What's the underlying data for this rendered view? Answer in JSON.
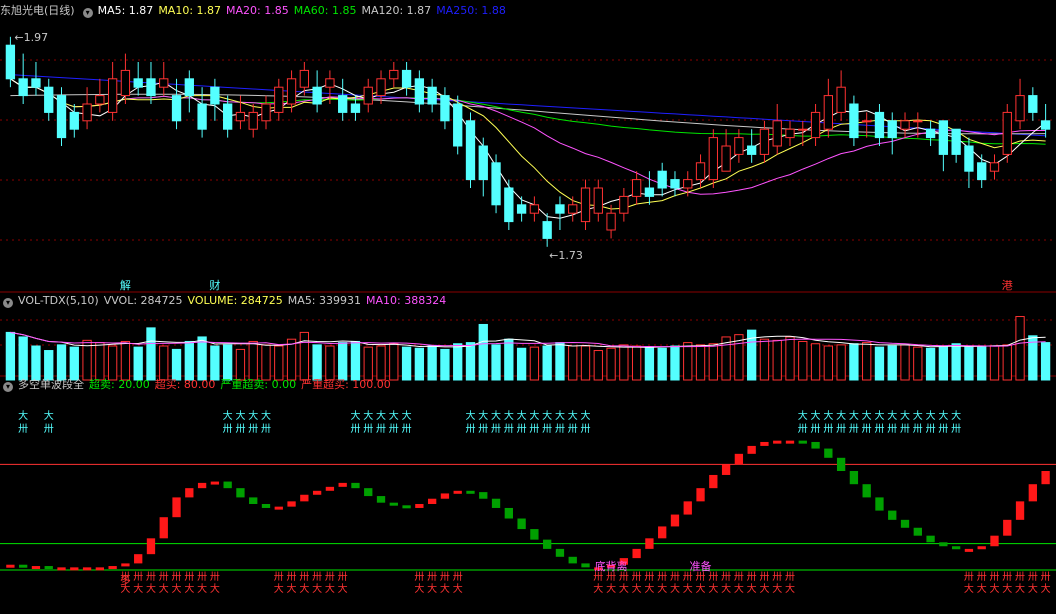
{
  "stock": {
    "name": "东旭光电",
    "period": "(日线)"
  },
  "colors": {
    "up": "#ff3232",
    "down": "#54ffff",
    "ma5": "#ffffff",
    "ma10": "#ffff54",
    "ma20": "#ff54ff",
    "ma60": "#00e600",
    "ma120": "#c8c8c8",
    "ma250": "#1f1fff",
    "grid": "#8a0000",
    "wave_up": "#ff1818",
    "wave_down": "#00a000",
    "sig_cyan": "#54ffff",
    "sig_red": "#ff3232"
  },
  "main": {
    "ma_labels": [
      {
        "text": "MA5: 1.87",
        "key": "ma5"
      },
      {
        "text": "MA10: 1.87",
        "key": "ma10"
      },
      {
        "text": "MA20: 1.85",
        "key": "ma20"
      },
      {
        "text": "MA60: 1.85",
        "key": "ma60"
      },
      {
        "text": "MA120: 1.87",
        "key": "ma120"
      },
      {
        "text": "MA250: 1.88",
        "key": "ma250"
      }
    ],
    "high_label": "1.97",
    "low_label": "1.73",
    "events": [
      {
        "text": "解",
        "index": 9
      },
      {
        "text": "财",
        "index": 16
      },
      {
        "text": "港",
        "index": 78
      }
    ]
  },
  "volume": {
    "labels": [
      {
        "text": "VOL-TDX(5,10)",
        "color": "#c8c8c8"
      },
      {
        "text": "VVOL: 284725",
        "color": "#c8c8c8"
      },
      {
        "text": "VOLUME: 284725",
        "color": "#ffff54"
      },
      {
        "text": "MA5: 339931",
        "color": "#c8c8c8"
      },
      {
        "text": "MA10: 388324",
        "color": "#ff54ff"
      }
    ]
  },
  "indicator": {
    "labels": [
      {
        "text": "多空单波段全",
        "color": "#c8c8c8"
      },
      {
        "text": "超卖: 20.00",
        "color": "#00e600"
      },
      {
        "text": "超买: 80.00",
        "color": "#ff3232"
      },
      {
        "text": "严重超卖: 0.00",
        "color": "#00e600"
      },
      {
        "text": "严重超买: 100.00",
        "color": "#ff3232"
      }
    ],
    "annotations": [
      {
        "text": "多",
        "index": 9,
        "color": "#ff3232"
      },
      {
        "text": "底背离",
        "index": 47,
        "color": "#ff54ff"
      },
      {
        "text": "准备",
        "index": 54,
        "color": "#ff54ff"
      }
    ]
  },
  "chart_data": [
    {
      "type": "candlestick",
      "title": "东旭光电 (日线)",
      "x": [
        0,
        1,
        2,
        3,
        4,
        5,
        6,
        7,
        8,
        9,
        10,
        11,
        12,
        13,
        14,
        15,
        16,
        17,
        18,
        19,
        20,
        21,
        22,
        23,
        24,
        25,
        26,
        27,
        28,
        29,
        30,
        31,
        32,
        33,
        34,
        35,
        36,
        37,
        38,
        39,
        40,
        41,
        42,
        43,
        44,
        45,
        46,
        47,
        48,
        49,
        50,
        51,
        52,
        53,
        54,
        55,
        56,
        57,
        58,
        59,
        60,
        61,
        62,
        63,
        64,
        65,
        66,
        67,
        68,
        69,
        70,
        71,
        72,
        73,
        74,
        75,
        76,
        77,
        78,
        79,
        80,
        81
      ],
      "open": [
        1.97,
        1.93,
        1.93,
        1.92,
        1.91,
        1.89,
        1.88,
        1.9,
        1.89,
        1.91,
        1.93,
        1.93,
        1.92,
        1.91,
        1.93,
        1.9,
        1.92,
        1.9,
        1.88,
        1.87,
        1.88,
        1.89,
        1.9,
        1.92,
        1.92,
        1.92,
        1.91,
        1.9,
        1.9,
        1.91,
        1.93,
        1.94,
        1.93,
        1.92,
        1.91,
        1.9,
        1.88,
        1.85,
        1.83,
        1.8,
        1.78,
        1.77,
        1.76,
        1.78,
        1.77,
        1.76,
        1.77,
        1.75,
        1.77,
        1.79,
        1.8,
        1.82,
        1.81,
        1.8,
        1.81,
        1.81,
        1.82,
        1.84,
        1.85,
        1.84,
        1.85,
        1.86,
        1.87,
        1.86,
        1.87,
        1.89,
        1.9,
        1.88,
        1.89,
        1.88,
        1.87,
        1.88,
        1.87,
        1.88,
        1.87,
        1.85,
        1.83,
        1.82,
        1.84,
        1.88,
        1.91,
        1.88
      ],
      "close": [
        1.93,
        1.91,
        1.92,
        1.89,
        1.86,
        1.87,
        1.9,
        1.91,
        1.93,
        1.94,
        1.92,
        1.91,
        1.93,
        1.88,
        1.91,
        1.87,
        1.9,
        1.87,
        1.89,
        1.89,
        1.9,
        1.92,
        1.93,
        1.94,
        1.9,
        1.93,
        1.89,
        1.89,
        1.92,
        1.93,
        1.94,
        1.92,
        1.9,
        1.9,
        1.88,
        1.85,
        1.81,
        1.81,
        1.78,
        1.76,
        1.77,
        1.78,
        1.74,
        1.77,
        1.78,
        1.8,
        1.8,
        1.77,
        1.79,
        1.81,
        1.79,
        1.8,
        1.8,
        1.81,
        1.83,
        1.86,
        1.85,
        1.86,
        1.84,
        1.87,
        1.88,
        1.87,
        1.87,
        1.89,
        1.91,
        1.92,
        1.86,
        1.88,
        1.86,
        1.86,
        1.88,
        1.88,
        1.86,
        1.84,
        1.84,
        1.82,
        1.81,
        1.83,
        1.89,
        1.91,
        1.89,
        1.87
      ],
      "high": [
        1.98,
        1.96,
        1.95,
        1.93,
        1.92,
        1.9,
        1.92,
        1.93,
        1.95,
        1.96,
        1.95,
        1.95,
        1.95,
        1.93,
        1.94,
        1.92,
        1.93,
        1.91,
        1.91,
        1.9,
        1.91,
        1.93,
        1.94,
        1.95,
        1.94,
        1.94,
        1.93,
        1.91,
        1.93,
        1.94,
        1.95,
        1.95,
        1.94,
        1.93,
        1.92,
        1.91,
        1.89,
        1.86,
        1.84,
        1.81,
        1.79,
        1.79,
        1.77,
        1.79,
        1.79,
        1.81,
        1.81,
        1.78,
        1.8,
        1.82,
        1.82,
        1.83,
        1.82,
        1.82,
        1.84,
        1.87,
        1.87,
        1.87,
        1.87,
        1.88,
        1.9,
        1.88,
        1.88,
        1.9,
        1.93,
        1.94,
        1.91,
        1.89,
        1.9,
        1.89,
        1.89,
        1.89,
        1.88,
        1.88,
        1.87,
        1.86,
        1.84,
        1.84,
        1.9,
        1.93,
        1.92,
        1.9
      ],
      "low": [
        1.92,
        1.9,
        1.91,
        1.88,
        1.85,
        1.86,
        1.87,
        1.89,
        1.88,
        1.9,
        1.91,
        1.9,
        1.91,
        1.87,
        1.89,
        1.86,
        1.88,
        1.86,
        1.87,
        1.86,
        1.87,
        1.88,
        1.89,
        1.91,
        1.89,
        1.9,
        1.88,
        1.88,
        1.89,
        1.9,
        1.92,
        1.91,
        1.89,
        1.89,
        1.87,
        1.84,
        1.8,
        1.79,
        1.77,
        1.75,
        1.76,
        1.76,
        1.73,
        1.75,
        1.76,
        1.75,
        1.76,
        1.74,
        1.76,
        1.78,
        1.78,
        1.79,
        1.79,
        1.79,
        1.8,
        1.8,
        1.82,
        1.83,
        1.83,
        1.83,
        1.84,
        1.85,
        1.85,
        1.85,
        1.86,
        1.88,
        1.85,
        1.86,
        1.85,
        1.84,
        1.86,
        1.86,
        1.85,
        1.82,
        1.83,
        1.8,
        1.8,
        1.81,
        1.83,
        1.87,
        1.88,
        1.86
      ],
      "ylim": [
        1.7,
        2.0
      ]
    },
    {
      "type": "bar",
      "title": "VOL-TDX(5,10)",
      "values": [
        420,
        380,
        300,
        260,
        310,
        290,
        350,
        330,
        300,
        340,
        290,
        460,
        300,
        270,
        340,
        380,
        300,
        310,
        270,
        340,
        310,
        300,
        360,
        420,
        310,
        300,
        330,
        340,
        290,
        300,
        320,
        290,
        280,
        300,
        270,
        320,
        330,
        490,
        310,
        360,
        280,
        290,
        300,
        330,
        300,
        300,
        260,
        280,
        310,
        300,
        290,
        280,
        300,
        330,
        310,
        320,
        380,
        400,
        440,
        360,
        350,
        380,
        340,
        320,
        300,
        310,
        320,
        330,
        290,
        300,
        310,
        290,
        280,
        300,
        320,
        290,
        300,
        300,
        310,
        560,
        390,
        330
      ],
      "ylim": [
        0,
        600
      ]
    },
    {
      "type": "bar",
      "title": "多空单波段全",
      "values": [
        4,
        3,
        3,
        2,
        2,
        2,
        2,
        2,
        3,
        5,
        12,
        24,
        40,
        55,
        62,
        66,
        67,
        62,
        55,
        50,
        47,
        48,
        52,
        57,
        60,
        63,
        66,
        62,
        56,
        51,
        49,
        47,
        50,
        54,
        58,
        60,
        59,
        54,
        47,
        39,
        31,
        23,
        16,
        10,
        5,
        2,
        2,
        4,
        9,
        16,
        24,
        33,
        42,
        52,
        62,
        72,
        80,
        88,
        94,
        97,
        98,
        98,
        97,
        92,
        85,
        75,
        65,
        55,
        45,
        38,
        32,
        26,
        21,
        18,
        16,
        16,
        18,
        26,
        38,
        52,
        65,
        75
      ],
      "ylim": [
        0,
        100
      ],
      "reference_lines": [
        20,
        80
      ]
    }
  ]
}
